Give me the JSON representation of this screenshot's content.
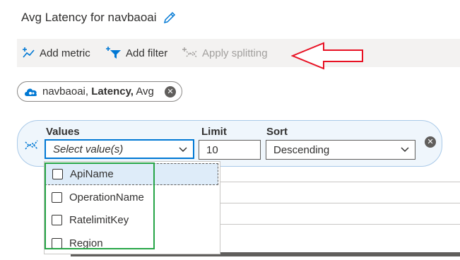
{
  "header": {
    "title": "Avg Latency for navbaoai"
  },
  "toolbar": {
    "add_metric": "Add metric",
    "add_filter": "Add filter",
    "apply_splitting": "Apply splitting"
  },
  "metric_pill": {
    "resource": "navbaoai, ",
    "metric": "Latency,",
    "aggregation": " Avg"
  },
  "splitting": {
    "values_label": "Values",
    "values_placeholder": "Select value(s)",
    "limit_label": "Limit",
    "limit_value": "10",
    "sort_label": "Sort",
    "sort_value": "Descending"
  },
  "dropdown_options": [
    "ApiName",
    "OperationName",
    "RatelimitKey",
    "Region"
  ],
  "colors": {
    "annotation_arrow": "#e81123",
    "annotation_box": "#26a547",
    "accent": "#0078d4"
  }
}
